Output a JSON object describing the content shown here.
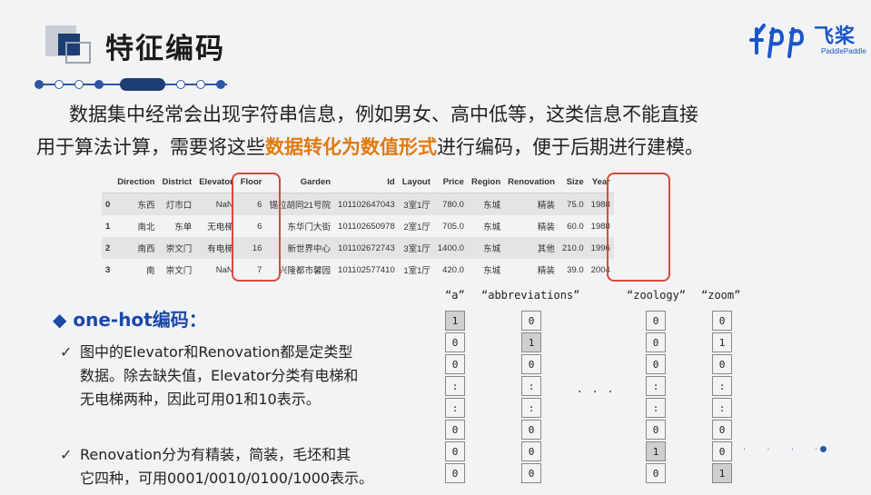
{
  "title": "特征编码",
  "logo": {
    "cn": "飞桨",
    "en": "PaddlePaddle"
  },
  "paragraph": {
    "line1": "数据集中经常会出现字符串信息，例如男女、高中低等，这类信息不能直接",
    "line2_pre": "用于算法计算，需要将这些",
    "line2_highlight": "数据转化为数值形式",
    "line2_post": "进行编码，便于后期进行建模。"
  },
  "table": {
    "headers": [
      "",
      "Direction",
      "District",
      "Elevator",
      "Floor",
      "Garden",
      "Id",
      "Layout",
      "Price",
      "Region",
      "Renovation",
      "Size",
      "Year"
    ],
    "rows": [
      [
        "0",
        "东西",
        "灯市口",
        "NaN",
        "6",
        "锡拉胡同21号院",
        "101102647043",
        "3室1厅",
        "780.0",
        "东城",
        "精装",
        "75.0",
        "1988"
      ],
      [
        "1",
        "南北",
        "东单",
        "无电梯",
        "6",
        "东华门大街",
        "101102650978",
        "2室1厅",
        "705.0",
        "东城",
        "精装",
        "60.0",
        "1988"
      ],
      [
        "2",
        "南西",
        "崇文门",
        "有电梯",
        "16",
        "新世界中心",
        "101102672743",
        "3室1厅",
        "1400.0",
        "东城",
        "其他",
        "210.0",
        "1996"
      ],
      [
        "3",
        "南",
        "崇文门",
        "NaN",
        "7",
        "兴隆都市馨园",
        "101102577410",
        "1室1厅",
        "420.0",
        "东城",
        "精装",
        "39.0",
        "2004"
      ]
    ]
  },
  "onehot": {
    "title": "◆ one-hot编码：",
    "check": "✓",
    "bullet1": [
      "图中的Elevator和Renovation都是定类型",
      "数据。除去缺失值，Elevator分类有电梯和",
      "无电梯两种，因此可用01和10表示。"
    ],
    "bullet2": [
      "Renovation分为有精装，简装，毛坯和其",
      "它四种，可用0001/0010/0100/1000表示。"
    ]
  },
  "vectors": [
    {
      "label": "“a”",
      "cells": [
        "1",
        "0",
        "0",
        ":",
        ":",
        "0",
        "0",
        "0"
      ],
      "gray": [
        0
      ]
    },
    {
      "label": "“abbreviations”",
      "cells": [
        "0",
        "1",
        "0",
        ":",
        ":",
        "0",
        "0",
        "0"
      ],
      "gray": [
        1
      ]
    },
    {
      "label": "“zoology”",
      "cells": [
        "0",
        "0",
        "0",
        ":",
        ":",
        "0",
        "1",
        "0"
      ],
      "gray": [
        6
      ]
    },
    {
      "label": "“zoom”",
      "cells": [
        "0",
        "1",
        "0",
        ":",
        ":",
        "0",
        "0",
        "1"
      ],
      "gray": [
        7
      ]
    }
  ],
  "mid_dots": "· · ·",
  "trail": "· · · ·"
}
